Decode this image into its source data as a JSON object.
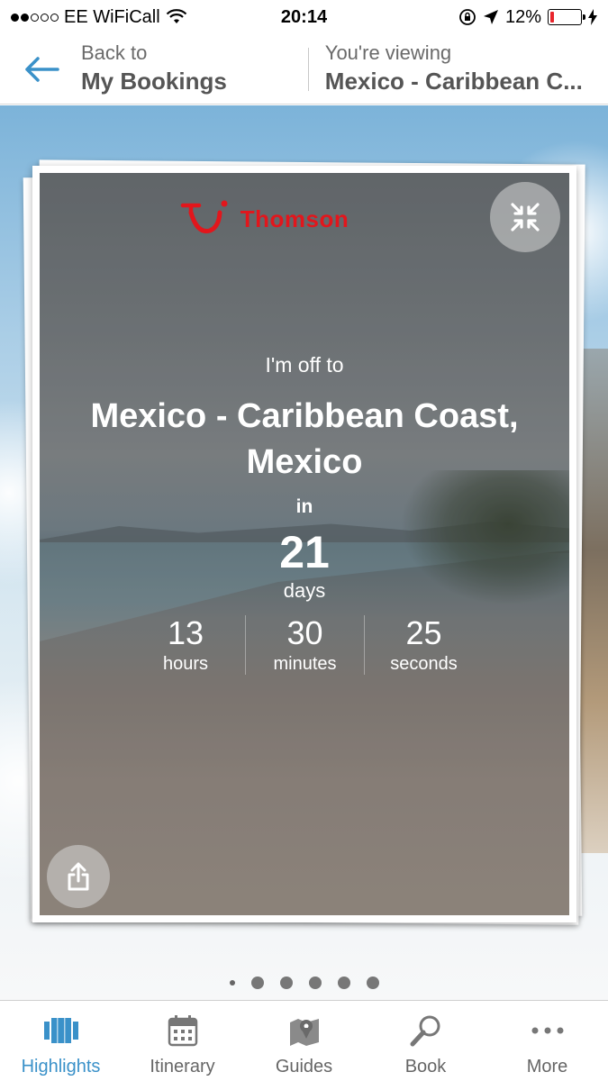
{
  "status_bar": {
    "carrier": "EE WiFiCall",
    "time": "20:14",
    "battery": "12%",
    "battery_level": 0.12
  },
  "header": {
    "back_small": "Back to",
    "back_big": "My Bookings",
    "viewing_small": "You're viewing",
    "viewing_big": "Mexico - Caribbean C..."
  },
  "card": {
    "brand": "Thomson",
    "off_to": "I'm off to",
    "destination": "Mexico - Caribbean Coast, Mexico",
    "in_word": "in",
    "days": "21",
    "days_label": "days",
    "countdown": [
      {
        "value": "13",
        "label": "hours"
      },
      {
        "value": "30",
        "label": "minutes"
      },
      {
        "value": "25",
        "label": "seconds"
      }
    ]
  },
  "pager": {
    "count": 6,
    "active_index": 0
  },
  "tabs": [
    {
      "label": "Highlights",
      "icon": "highlights-icon",
      "active": true
    },
    {
      "label": "Itinerary",
      "icon": "calendar-icon",
      "active": false
    },
    {
      "label": "Guides",
      "icon": "map-pin-icon",
      "active": false
    },
    {
      "label": "Book",
      "icon": "search-icon",
      "active": false
    },
    {
      "label": "More",
      "icon": "more-dots-icon",
      "active": false
    }
  ],
  "colors": {
    "accent": "#3a91c9",
    "brand_red": "#e2161c",
    "battery_low": "#e8262c"
  }
}
